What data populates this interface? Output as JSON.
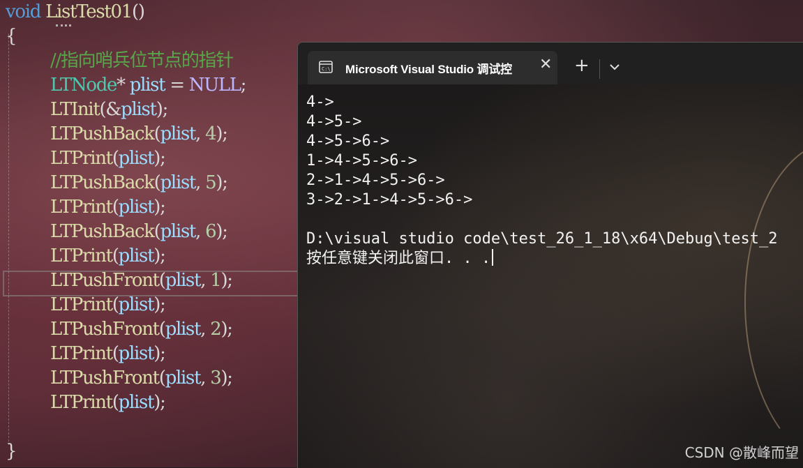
{
  "editor": {
    "lines": [
      {
        "tokens": [
          {
            "t": "void",
            "c": "kw"
          },
          {
            "t": " ",
            "c": "pl"
          },
          {
            "t": "ListTest01",
            "c": "fn"
          },
          {
            "t": "()",
            "c": "pl"
          }
        ]
      },
      {
        "tokens": [
          {
            "t": "{",
            "c": "pl"
          }
        ]
      },
      {
        "indent": true,
        "tokens": [
          {
            "t": "//指向哨兵位节点的指针",
            "c": "cm"
          }
        ]
      },
      {
        "indent": true,
        "tokens": [
          {
            "t": "LTNode",
            "c": "ty"
          },
          {
            "t": "* ",
            "c": "pl"
          },
          {
            "t": "plist",
            "c": "var"
          },
          {
            "t": " = ",
            "c": "pl"
          },
          {
            "t": "NULL",
            "c": "mac"
          },
          {
            "t": ";",
            "c": "pl"
          }
        ]
      },
      {
        "indent": true,
        "tokens": [
          {
            "t": "LTInit",
            "c": "fn"
          },
          {
            "t": "(&",
            "c": "pl"
          },
          {
            "t": "plist",
            "c": "var"
          },
          {
            "t": ");",
            "c": "pl"
          }
        ]
      },
      {
        "indent": true,
        "tokens": [
          {
            "t": "LTPushBack",
            "c": "fn"
          },
          {
            "t": "(",
            "c": "pl"
          },
          {
            "t": "plist",
            "c": "var"
          },
          {
            "t": ", ",
            "c": "pl"
          },
          {
            "t": "4",
            "c": "num"
          },
          {
            "t": ");",
            "c": "pl"
          }
        ]
      },
      {
        "indent": true,
        "tokens": [
          {
            "t": "LTPrint",
            "c": "fn"
          },
          {
            "t": "(",
            "c": "pl"
          },
          {
            "t": "plist",
            "c": "var"
          },
          {
            "t": ");",
            "c": "pl"
          }
        ]
      },
      {
        "indent": true,
        "tokens": [
          {
            "t": "LTPushBack",
            "c": "fn"
          },
          {
            "t": "(",
            "c": "pl"
          },
          {
            "t": "plist",
            "c": "var"
          },
          {
            "t": ", ",
            "c": "pl"
          },
          {
            "t": "5",
            "c": "num"
          },
          {
            "t": ");",
            "c": "pl"
          }
        ]
      },
      {
        "indent": true,
        "tokens": [
          {
            "t": "LTPrint",
            "c": "fn"
          },
          {
            "t": "(",
            "c": "pl"
          },
          {
            "t": "plist",
            "c": "var"
          },
          {
            "t": ");",
            "c": "pl"
          }
        ]
      },
      {
        "indent": true,
        "tokens": [
          {
            "t": "LTPushBack",
            "c": "fn"
          },
          {
            "t": "(",
            "c": "pl"
          },
          {
            "t": "plist",
            "c": "var"
          },
          {
            "t": ", ",
            "c": "pl"
          },
          {
            "t": "6",
            "c": "num"
          },
          {
            "t": ");",
            "c": "pl"
          }
        ]
      },
      {
        "indent": true,
        "tokens": [
          {
            "t": "LTPrint",
            "c": "fn"
          },
          {
            "t": "(",
            "c": "pl"
          },
          {
            "t": "plist",
            "c": "var"
          },
          {
            "t": ");",
            "c": "pl"
          }
        ]
      },
      {
        "indent": true,
        "tokens": [
          {
            "t": "LTPushFront",
            "c": "fn"
          },
          {
            "t": "(",
            "c": "pl"
          },
          {
            "t": "plist",
            "c": "var"
          },
          {
            "t": ", ",
            "c": "pl"
          },
          {
            "t": "1",
            "c": "num"
          },
          {
            "t": ");",
            "c": "pl"
          }
        ]
      },
      {
        "indent": true,
        "tokens": [
          {
            "t": "LTPrint",
            "c": "fn"
          },
          {
            "t": "(",
            "c": "pl"
          },
          {
            "t": "plist",
            "c": "var"
          },
          {
            "t": ");",
            "c": "pl"
          }
        ]
      },
      {
        "indent": true,
        "tokens": [
          {
            "t": "LTPushFront",
            "c": "fn"
          },
          {
            "t": "(",
            "c": "pl"
          },
          {
            "t": "plist",
            "c": "var"
          },
          {
            "t": ", ",
            "c": "pl"
          },
          {
            "t": "2",
            "c": "num"
          },
          {
            "t": ");",
            "c": "pl"
          }
        ]
      },
      {
        "indent": true,
        "tokens": [
          {
            "t": "LTPrint",
            "c": "fn"
          },
          {
            "t": "(",
            "c": "pl"
          },
          {
            "t": "plist",
            "c": "var"
          },
          {
            "t": ");",
            "c": "pl"
          }
        ]
      },
      {
        "indent": true,
        "tokens": [
          {
            "t": "LTPushFront",
            "c": "fn"
          },
          {
            "t": "(",
            "c": "pl"
          },
          {
            "t": "plist",
            "c": "var"
          },
          {
            "t": ", ",
            "c": "pl"
          },
          {
            "t": "3",
            "c": "num"
          },
          {
            "t": ");",
            "c": "pl"
          }
        ]
      },
      {
        "indent": true,
        "tokens": [
          {
            "t": "LTPrint",
            "c": "fn"
          },
          {
            "t": "(",
            "c": "pl"
          },
          {
            "t": "plist",
            "c": "var"
          },
          {
            "t": ");",
            "c": "pl"
          }
        ]
      },
      {
        "tokens": []
      },
      {
        "tokens": [
          {
            "t": "}",
            "c": "pl"
          }
        ]
      }
    ],
    "colors": {
      "keyword": "#569cd6",
      "function": "#dcdcaa",
      "type": "#4ec9b0",
      "variable": "#9cdcfe",
      "number": "#b5cea8",
      "macro": "#beb7ff",
      "comment": "#57a64a",
      "plain": "#d8d8d8"
    }
  },
  "terminal": {
    "tab_title": "Microsoft Visual Studio 调试控",
    "tab_icon": "console-icon",
    "close_icon": "close-icon",
    "new_tab_icon": "plus-icon",
    "dropdown_icon": "chevron-down-icon",
    "output_lines": [
      "4->",
      "4->5->",
      "4->5->6->",
      "1->4->5->6->",
      "2->1->4->5->6->",
      "3->2->1->4->5->6->",
      "",
      "D:\\visual studio code\\test_26_1_18\\x64\\Debug\\test_2",
      "按任意键关闭此窗口. . ."
    ]
  },
  "watermark": "CSDN @散峰而望"
}
